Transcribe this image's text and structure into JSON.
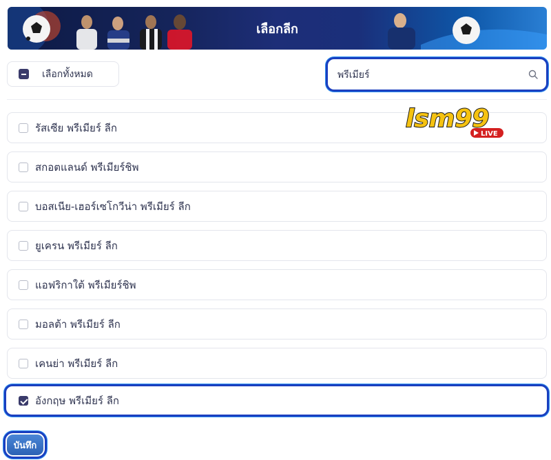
{
  "header": {
    "title": "เลือกลีก"
  },
  "select_all": {
    "label": "เลือกทั้งหมด"
  },
  "search": {
    "value": "พรีเมียร์",
    "icon": "search-icon"
  },
  "leagues": [
    {
      "label": "รัสเซีย พรีเมียร์ ลีก",
      "checked": false
    },
    {
      "label": "สกอตแลนด์ พรีเมียร์ชิพ",
      "checked": false
    },
    {
      "label": "บอสเนีย-เฮอร์เซโกวีน่า พรีเมียร์ ลีก",
      "checked": false
    },
    {
      "label": "ยูเครน พรีเมียร์ ลีก",
      "checked": false
    },
    {
      "label": "แอฟริกาใต้ พรีเมียร์ชิพ",
      "checked": false
    },
    {
      "label": "มอลต้า พรีเมียร์ ลีก",
      "checked": false
    },
    {
      "label": "เคนย่า พรีเมียร์ ลีก",
      "checked": false
    },
    {
      "label": "อังกฤษ พรีเมียร์ ลีก",
      "checked": true
    }
  ],
  "logo": {
    "text": "lsm99",
    "badge": "LIVE"
  },
  "save_button": {
    "label": "บันทึก"
  },
  "colors": {
    "accent": "#1b3fbf",
    "checkbox": "#3a3b6b",
    "save": "#3a72c4"
  }
}
